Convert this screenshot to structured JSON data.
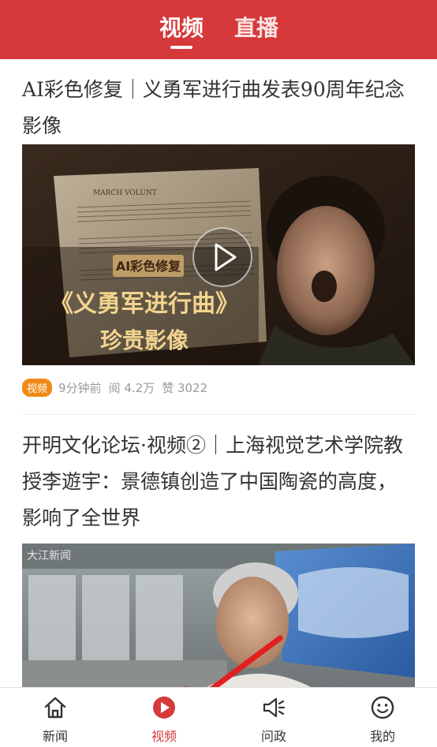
{
  "header": {
    "tabs": [
      {
        "label": "视频",
        "active": true
      },
      {
        "label": "直播",
        "active": false
      }
    ],
    "color": "#d6393a"
  },
  "feed": {
    "items": [
      {
        "title": "AI彩色修复｜义勇军进行曲发表90周年纪念影像",
        "thumbnail": {
          "score_heading": "MARCH VOLUNT",
          "badge_text": "AI彩色修复",
          "headline": "《义勇军进行曲》",
          "subheadline": "珍贵影像"
        },
        "badge": "视频",
        "time": "9分钟前",
        "reads": "阅 4.2万",
        "likes": "赞 3022"
      },
      {
        "title": "开明文化论坛·视频②｜上海视觉艺术学院教授李遊宇：景德镇创造了中国陶瓷的高度，影响了全世界",
        "thumbnail": {
          "watermark": "大江新闻"
        }
      }
    ]
  },
  "bottom_nav": {
    "items": [
      {
        "label": "新闻",
        "icon": "home-icon",
        "active": false
      },
      {
        "label": "视频",
        "icon": "play-circle-icon",
        "active": true
      },
      {
        "label": "问政",
        "icon": "megaphone-icon",
        "active": false
      },
      {
        "label": "我的",
        "icon": "smiley-icon",
        "active": false
      }
    ],
    "active_color": "#d6393a"
  },
  "annotation": {
    "type": "red-arrow",
    "color": "#e21e1e"
  }
}
